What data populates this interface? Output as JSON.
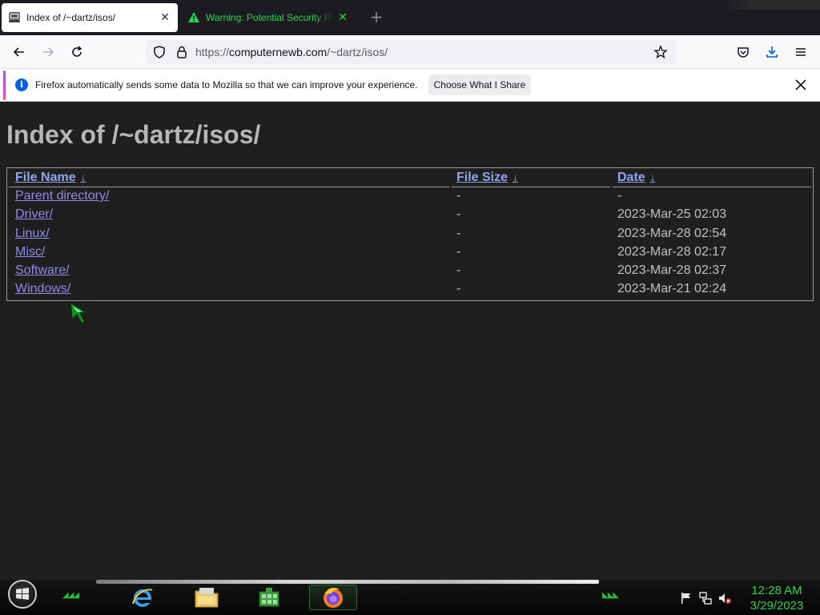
{
  "tabs": [
    {
      "title": "Index of /~dartz/isos/",
      "active": true
    },
    {
      "title": "Warning: Potential Security Risk",
      "active": false
    }
  ],
  "navbar": {
    "url_scheme": "https://",
    "url_host": "computernewb.com",
    "url_path": "/~dartz/isos/"
  },
  "notification": {
    "message": "Firefox automatically sends some data to Mozilla so that we can improve your experience.",
    "button_label": "Choose What I Share"
  },
  "page": {
    "heading": "Index of /~dartz/isos/",
    "columns": {
      "name": "File Name",
      "size": "File Size",
      "date": "Date",
      "sort_arrow": "↓"
    },
    "rows": [
      {
        "name": "Parent directory/",
        "size": "-",
        "date": "-"
      },
      {
        "name": "Driver/",
        "size": "-",
        "date": "2023-Mar-25 02:03"
      },
      {
        "name": "Linux/",
        "size": "-",
        "date": "2023-Mar-28 02:54"
      },
      {
        "name": "Misc/",
        "size": "-",
        "date": "2023-Mar-28 02:17"
      },
      {
        "name": "Software/",
        "size": "-",
        "date": "2023-Mar-28 02:37"
      },
      {
        "name": "Windows/",
        "size": "-",
        "date": "2023-Mar-21 02:24"
      }
    ]
  },
  "taskbar": {
    "apps": [
      "internet-explorer-icon",
      "file-explorer-icon",
      "app-grid-icon",
      "firefox-icon"
    ],
    "clock_time": "12:28 AM",
    "clock_date": "3/29/2023"
  },
  "colors": {
    "accent_green": "#22d84a",
    "link": "#8e8ae6",
    "page_bg": "#1f1f1f"
  }
}
